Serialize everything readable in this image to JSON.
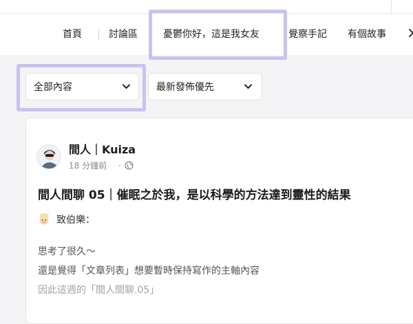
{
  "nav": {
    "tabs": [
      {
        "label": "首頁"
      },
      {
        "label": "討論區"
      },
      {
        "label": "憂鬱你好，這是我女友"
      },
      {
        "label": "覺察手記"
      },
      {
        "label": "有個故事"
      }
    ]
  },
  "filters": {
    "content": {
      "selected": "全部內容"
    },
    "sort": {
      "selected": "最新發佈優先"
    }
  },
  "post": {
    "author": "間人｜Kuiza",
    "time": "18 分鐘前",
    "separator": "·",
    "title": "間人間聊 05｜催眠之於我，是以科學的方法達到靈性的結果",
    "greeting": "致伯樂：",
    "lines": [
      "思考了很久～",
      "還是覺得「文章列表」想要暫時保持寫作的主軸內容",
      "因此這週的「間人間聊.05」"
    ]
  },
  "colors": {
    "highlight": "#c9c2f0",
    "background": "#f4f4f6"
  }
}
